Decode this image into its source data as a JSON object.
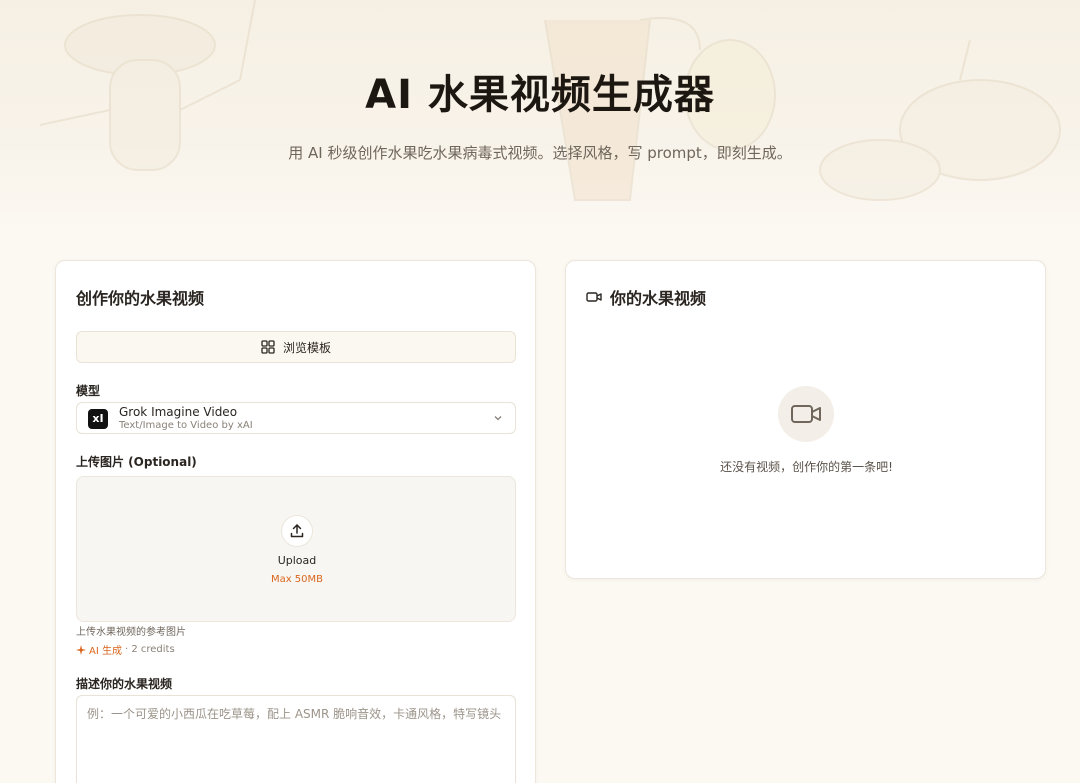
{
  "hero": {
    "title": "AI 水果视频生成器",
    "subtitle": "用 AI 秒级创作水果吃水果病毒式视频。选择风格，写 prompt，即刻生成。"
  },
  "form": {
    "title": "创作你的水果视频",
    "browse_templates_label": "浏览模板",
    "model_label": "模型",
    "model": {
      "logo": "xI",
      "name": "Grok Imagine Video",
      "description": "Text/Image to Video by xAI"
    },
    "upload_label": "上传图片 (Optional)",
    "upload_button_label": "Upload",
    "upload_max": "Max 50MB",
    "upload_hint": "上传水果视频的参考图片",
    "ai_generate_label": "AI 生成",
    "credits_text": "· 2 credits",
    "description_label": "描述你的水果视频",
    "description_placeholder": "例：一个可爱的小西瓜在吃草莓，配上 ASMR 脆响音效，卡通风格，特写镜头"
  },
  "preview": {
    "title": "你的水果视频",
    "empty_text": "还没有视频，创作你的第一条吧!"
  },
  "colors": {
    "accent": "#d9661f",
    "background": "#fcf9f3",
    "card": "#ffffff",
    "text": "#2a2520"
  },
  "icons": {
    "browse": "grid-icon",
    "chevron": "chevron-down-icon",
    "upload": "upload-icon",
    "ai": "sparkle-icon",
    "video": "video-camera-icon"
  }
}
